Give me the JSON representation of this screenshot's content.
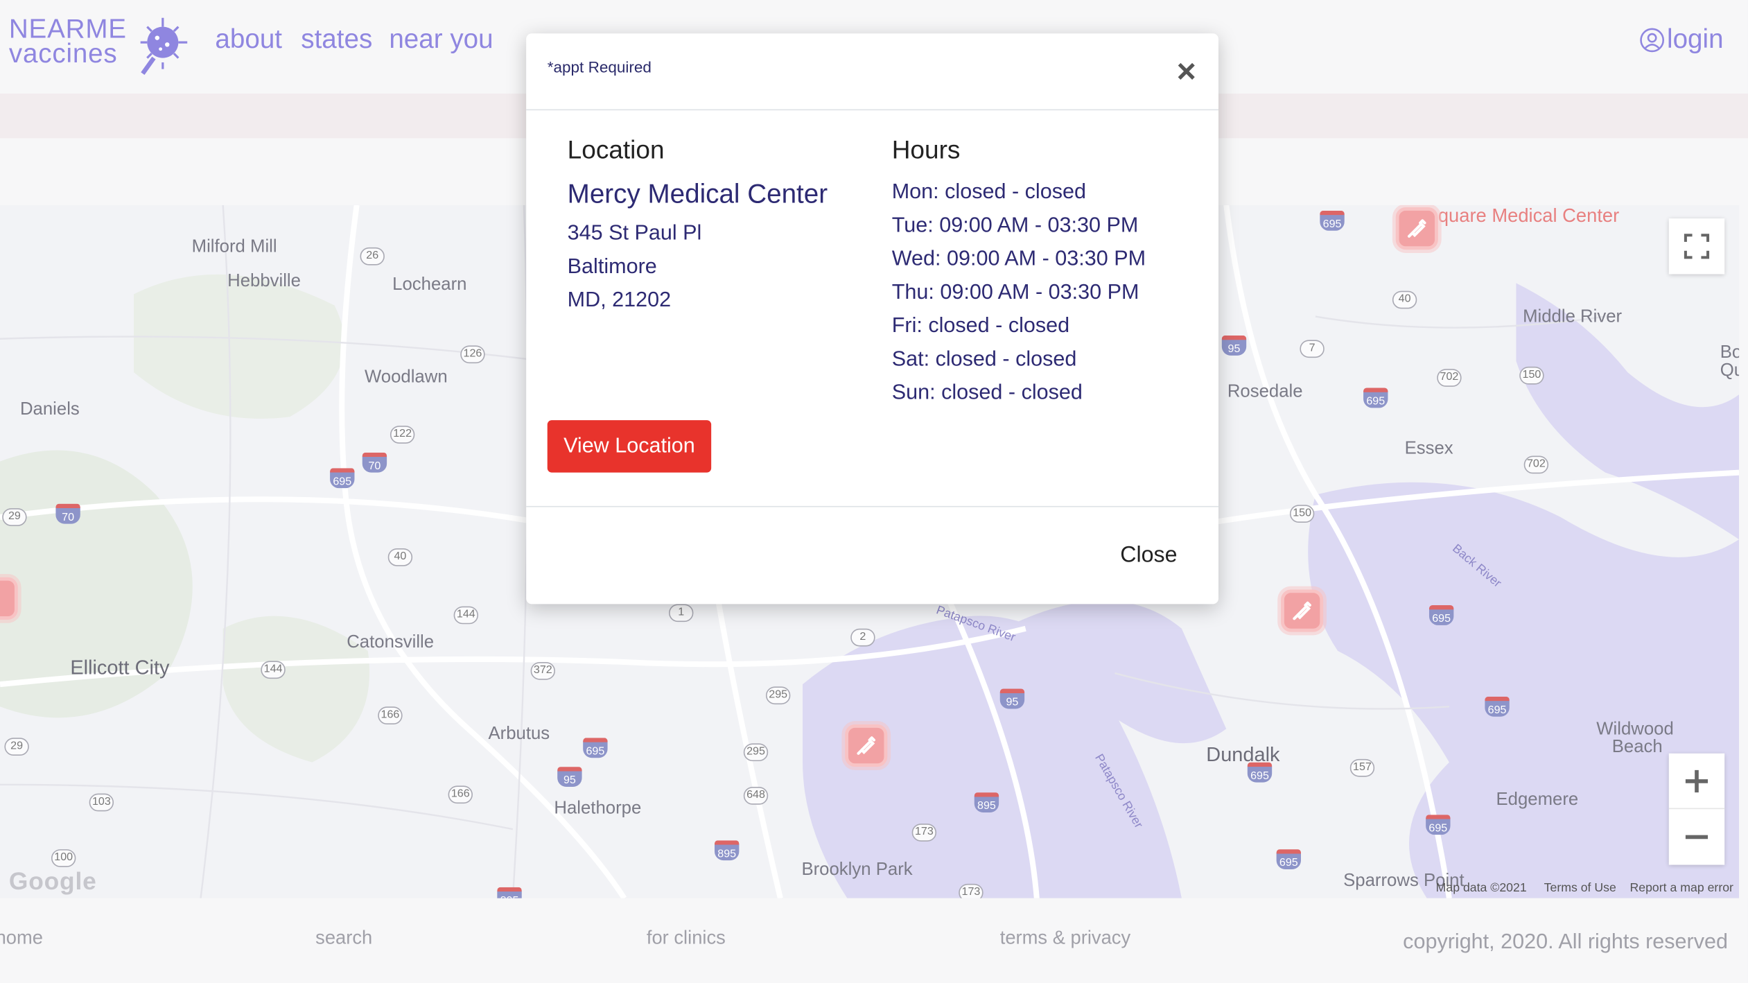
{
  "header": {
    "logo_line1": "NEARME",
    "logo_line2": "vaccines",
    "nav": [
      "about",
      "states",
      "near you"
    ],
    "login": "login"
  },
  "map": {
    "places": [
      {
        "name": "Milford Mill"
      },
      {
        "name": "Hebbville"
      },
      {
        "name": "Lochearn"
      },
      {
        "name": "Woodlawn"
      },
      {
        "name": "Daniels"
      },
      {
        "name": "Catonsville"
      },
      {
        "name": "Ellicott City"
      },
      {
        "name": "Arbutus"
      },
      {
        "name": "Halethorpe"
      },
      {
        "name": "Brooklyn Park"
      },
      {
        "name": "Middle River"
      },
      {
        "name": "Rosedale"
      },
      {
        "name": "Essex"
      },
      {
        "name": "Dundalk"
      },
      {
        "name": "Wildwood"
      },
      {
        "name": "Beach"
      },
      {
        "name": "Edgemere"
      },
      {
        "name": "Sparrows Point"
      },
      {
        "name": "Patapsco River"
      },
      {
        "name": "Back River"
      },
      {
        "name": "Bo"
      },
      {
        "name": "Qu"
      }
    ],
    "square_label": "quare Medical Center",
    "shields": [
      "26",
      "126",
      "122",
      "40",
      "144",
      "144",
      "372",
      "166",
      "166",
      "103",
      "100",
      "29",
      "29",
      "1",
      "2",
      "295",
      "295",
      "648",
      "173",
      "173",
      "7",
      "40",
      "702",
      "150",
      "702",
      "150",
      "157",
      "40"
    ],
    "interstates": [
      "695",
      "70",
      "70",
      "695",
      "95",
      "695",
      "95",
      "895",
      "895",
      "895",
      "695",
      "95",
      "695",
      "695",
      "695",
      "695",
      "695",
      "695"
    ],
    "google": "Google",
    "attribution": [
      "Map data ©2021",
      "Terms of Use",
      "Report a map error"
    ]
  },
  "modal": {
    "appt_note": "*appt Required",
    "location_heading": "Location",
    "hours_heading": "Hours",
    "location_name": "Mercy Medical Center",
    "address": [
      "345 St Paul Pl",
      "Baltimore",
      "MD, 21202"
    ],
    "hours": [
      "Mon: closed - closed",
      "Tue: 09:00 AM - 03:30 PM",
      "Wed: 09:00 AM - 03:30 PM",
      "Thu: 09:00 AM - 03:30 PM",
      "Fri: closed - closed",
      "Sat: closed - closed",
      "Sun: closed - closed"
    ],
    "view_button": "View Location",
    "close_button": "Close",
    "x_icon": "×"
  },
  "footer": {
    "links": [
      "home",
      "search",
      "for clinics",
      "terms & privacy"
    ],
    "copyright": "copyright, 2020. All rights reserved"
  },
  "colors": {
    "brand": "#8f86e0",
    "accent": "#e8332c",
    "text": "#2d2a73",
    "pin": "#f2a2a4"
  }
}
